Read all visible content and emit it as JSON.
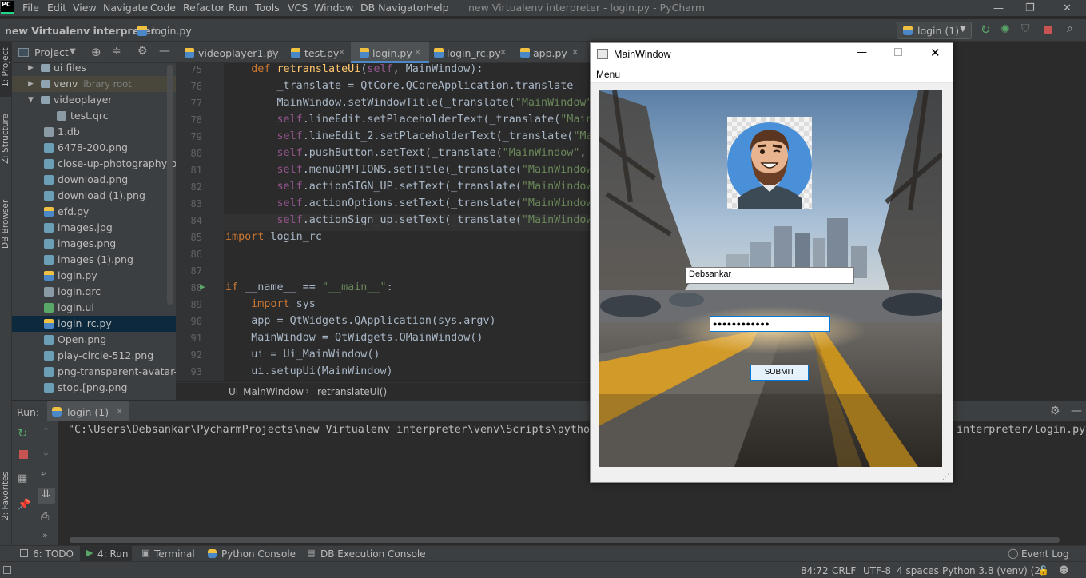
{
  "menubar": {
    "logo": "PC",
    "items": [
      "File",
      "Edit",
      "View",
      "Navigate",
      "Code",
      "Refactor",
      "Run",
      "Tools",
      "VCS",
      "Window",
      "DB Navigator",
      "Help"
    ],
    "window_title": "new Virtualenv interpreter - login.py - PyCharm"
  },
  "navbar": {
    "project": "new Virtualenv interpreter",
    "file": "login.py",
    "run_config": "login (1)"
  },
  "left_stripe": {
    "project": "1: Project",
    "structure": "Z: Structure",
    "db_browser": "DB Browser",
    "favorites": "2: Favorites"
  },
  "project_panel": {
    "title": "Project",
    "tree": [
      {
        "label": "ui files",
        "type": "folder"
      },
      {
        "label": "venv",
        "extra": "library root",
        "type": "folder"
      },
      {
        "label": "videoplayer",
        "type": "folder-open"
      },
      {
        "label": "test.qrc",
        "type": "file"
      },
      {
        "label": "1.db",
        "type": "file"
      },
      {
        "label": "6478-200.png",
        "type": "image"
      },
      {
        "label": "close-up-photography-of-r",
        "type": "image"
      },
      {
        "label": "download.png",
        "type": "image"
      },
      {
        "label": "download (1).png",
        "type": "image"
      },
      {
        "label": "efd.py",
        "type": "python"
      },
      {
        "label": "images.jpg",
        "type": "image"
      },
      {
        "label": "images.png",
        "type": "image"
      },
      {
        "label": "images (1).png",
        "type": "image"
      },
      {
        "label": "login.py",
        "type": "python"
      },
      {
        "label": "login.qrc",
        "type": "file"
      },
      {
        "label": "login.ui",
        "type": "ui"
      },
      {
        "label": "login_rc.py",
        "type": "python"
      },
      {
        "label": "Open.png",
        "type": "image"
      },
      {
        "label": "play-circle-512.png",
        "type": "image"
      },
      {
        "label": "png-transparent-avatar-use",
        "type": "image"
      },
      {
        "label": "stop.[png.png",
        "type": "image"
      }
    ]
  },
  "editor": {
    "tabs": [
      "videoplayer1.py",
      "test.py",
      "login.py",
      "login_rc.py",
      "app.py"
    ],
    "line_numbers": [
      "75",
      "76",
      "77",
      "78",
      "79",
      "80",
      "81",
      "82",
      "83",
      "84",
      "85",
      "86",
      "87",
      "88",
      "89",
      "90",
      "91",
      "92",
      "93"
    ],
    "lines": [
      "    def retranslateUi(self, MainWindow):",
      "        _translate = QtCore.QCoreApplication.translate",
      "        MainWindow.setWindowTitle(_translate(\"MainWindow\"",
      "        self.lineEdit.setPlaceholderText(_translate(\"Main",
      "        self.lineEdit_2.setPlaceholderText(_translate(\"Ma",
      "        self.pushButton.setText(_translate(\"MainWindow\",",
      "        self.menuOPPTIONS.setTitle(_translate(\"MainWindow",
      "        self.actionSIGN_UP.setText(_translate(\"MainWindow",
      "        self.actionOptions.setText(_translate(\"MainWindow",
      "        self.actionSign_up.setText(_translate(\"MainWindow",
      "import login_rc",
      "",
      "",
      "if __name__ == \"__main__\":",
      "    import sys",
      "    app = QtWidgets.QApplication(sys.argv)",
      "    MainWindow = QtWidgets.QMainWindow()",
      "    ui = Ui_MainWindow()",
      "    ui.setupUi(MainWindow)"
    ],
    "breadcrumb": [
      "Ui_MainWindow",
      "retranslateUi()"
    ]
  },
  "run_panel": {
    "label": "Run:",
    "tab": "login (1)",
    "console_left": "\"C:\\Users\\Debsankar\\PycharmProjects\\new Virtualenv interpreter\\venv\\Scripts\\python",
    "console_right": "interpreter/login.py"
  },
  "tool_windows": {
    "todo": "6: TODO",
    "run": "4: Run",
    "terminal": "Terminal",
    "python_console": "Python Console",
    "db_console": "DB Execution Console",
    "event_log": "Event Log"
  },
  "status_bar": {
    "position": "84:72",
    "line_sep": "CRLF",
    "encoding": "UTF-8",
    "indent": "4 spaces",
    "interpreter": "Python 3.8 (venv) (2)"
  },
  "app_window": {
    "title": "MainWindow",
    "menu": "Menu",
    "username_value": "Debsankar",
    "password_mask": "●●●●●●●●●●●●",
    "submit_label": "SUBMIT"
  },
  "colors": {
    "ide_bg": "#2b2b2b",
    "panel_bg": "#3c3f41",
    "keyword": "#cc7832",
    "string": "#6a8759",
    "self": "#94558d",
    "function": "#ffc66d",
    "qt_accent": "#0078d7"
  }
}
